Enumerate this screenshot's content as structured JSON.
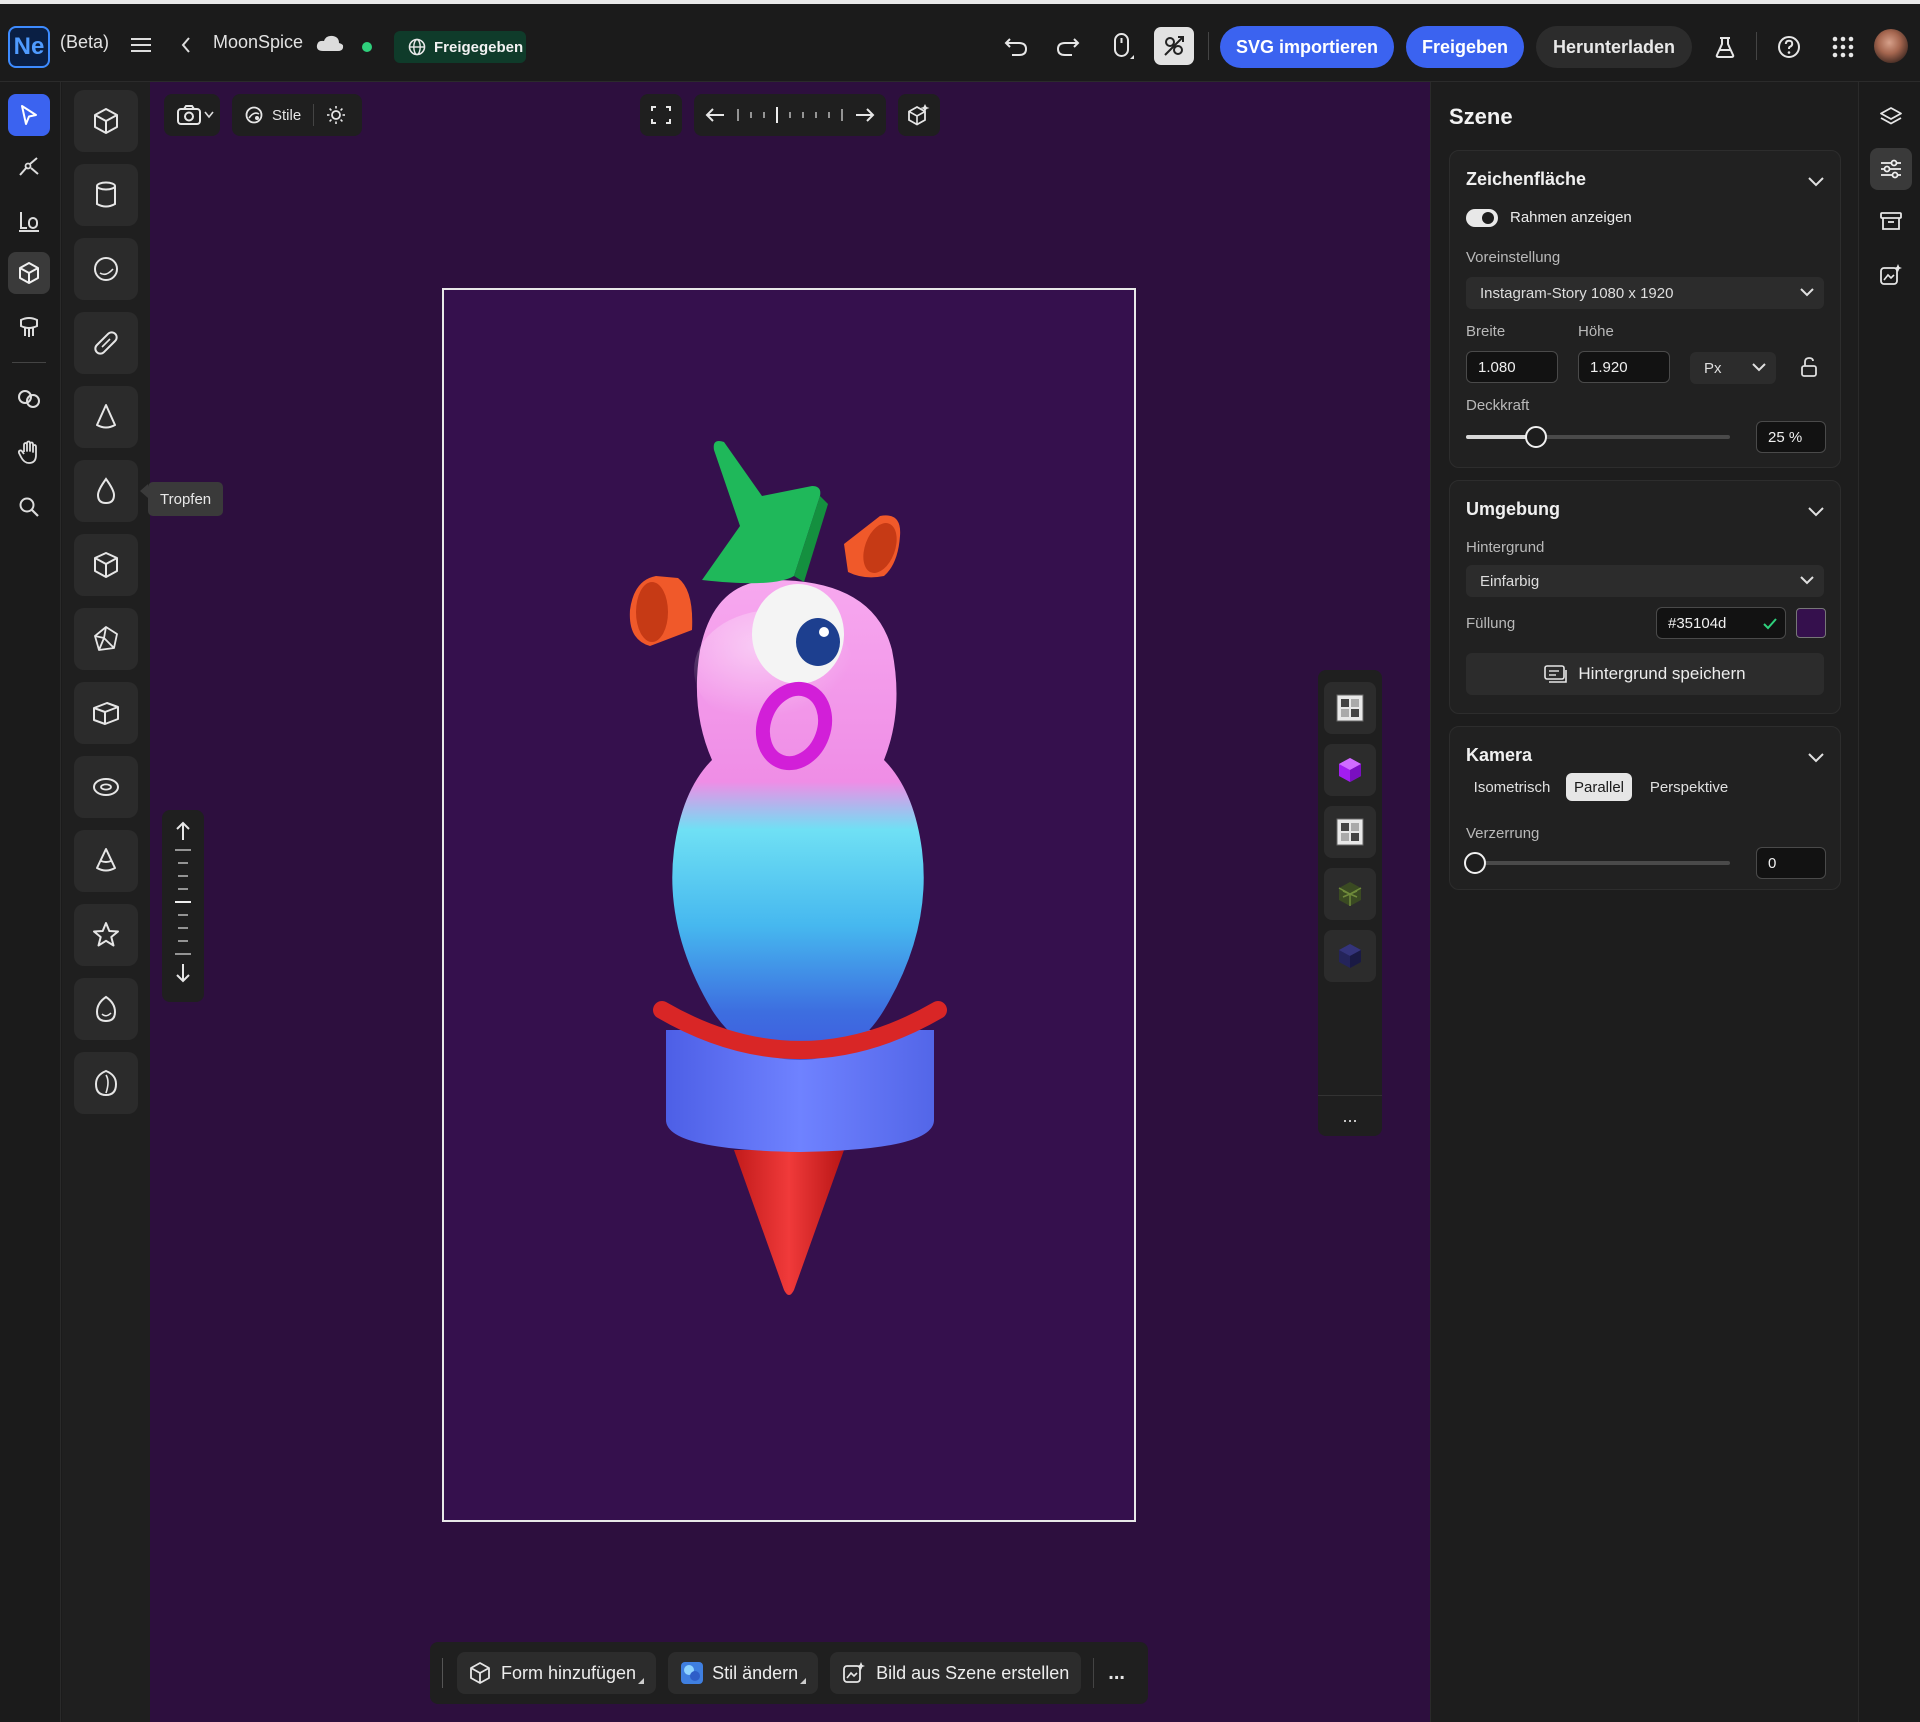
{
  "app": {
    "logo": "Ne",
    "beta": "(Beta)",
    "project": "MoonSpice",
    "shared_badge": "Freigegeben"
  },
  "topbar": {
    "import_svg": "SVG importieren",
    "share": "Freigeben",
    "download": "Herunterladen"
  },
  "canvas": {
    "toolbar": {
      "styles": "Stile"
    },
    "tooltip": "Tropfen",
    "bottom": {
      "add_shape": "Form hinzufügen",
      "change_style": "Stil ändern",
      "image_from_scene": "Bild aus Szene erstellen",
      "more": "..."
    },
    "side_more": "..."
  },
  "panel": {
    "title": "Szene",
    "artboard": {
      "title": "Zeichenfläche",
      "show_frame": "Rahmen anzeigen",
      "show_frame_on": true,
      "preset_label": "Voreinstellung",
      "preset_value": "Instagram-Story 1080 x 1920",
      "width_label": "Breite",
      "width_value": "1.080",
      "height_label": "Höhe",
      "height_value": "1.920",
      "unit": "Px",
      "opacity_label": "Deckkraft",
      "opacity_value": "25 %",
      "opacity_fraction": 0.25
    },
    "environment": {
      "title": "Umgebung",
      "background_label": "Hintergrund",
      "background_value": "Einfarbig",
      "fill_label": "Füllung",
      "fill_value": "#35104d",
      "save_background": "Hintergrund speichern"
    },
    "camera": {
      "title": "Kamera",
      "modes": [
        "Isometrisch",
        "Parallel",
        "Perspektive"
      ],
      "selected_mode": "Parallel",
      "distortion_label": "Verzerrung",
      "distortion_value": "0",
      "distortion_fraction": 0
    }
  },
  "colors": {
    "accent": "#3b63f0",
    "canvas_bg": "#2d0f3e",
    "artboard_bg": "#35104d",
    "online": "#2fd07c"
  }
}
